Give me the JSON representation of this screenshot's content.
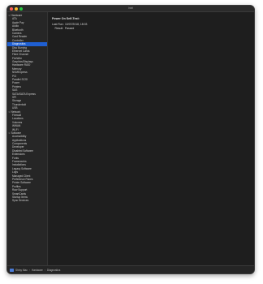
{
  "window": {
    "title": "Intel",
    "colors": {
      "close": "#ff5f57",
      "minimize": "#febc2e",
      "zoom": "#28c840",
      "selection": "#1f5fd1"
    }
  },
  "sidebar": {
    "groups": [
      {
        "label": "Hardware",
        "items": [
          "ATA",
          "Apple Pay",
          "Audio",
          "Bluetooth",
          "Camera",
          "Card Reader",
          "Controller",
          "Diagnostics",
          "Disc Burning",
          "Ethernet Cards",
          "Fibre Channel",
          "FireWire",
          "Graphics/Displays",
          "Hardware RAID",
          "Memory",
          "NVMExpress",
          "PCI",
          "Parallel SCSI",
          "Power",
          "Printers",
          "SAS",
          "SATA/SATA Express",
          "SPI",
          "Storage",
          "Thunderbolt",
          "USB"
        ]
      },
      {
        "label": "Network",
        "items": [
          "Firewall",
          "Locations",
          "Volumes",
          "WWAN",
          "Wi-Fi"
        ]
      },
      {
        "label": "Software",
        "items": [
          "Accessibility",
          "Applications",
          "Components",
          "Developer",
          "Disabled Software",
          "Extensions",
          "Fonts",
          "Frameworks",
          "Installations",
          "Legacy Software",
          "Logs",
          "Managed Client",
          "Preference Panes",
          "Printer Software",
          "Profiles",
          "Raw Support",
          "SmartCards",
          "Startup Items",
          "Sync Services"
        ]
      }
    ],
    "selected": "Diagnostics"
  },
  "detail": {
    "heading": "Power On Self-Test:",
    "rows": [
      {
        "key": "Last Run:",
        "value": "10/07/2018, 18:03"
      },
      {
        "key": "Result:",
        "value": "Passed"
      }
    ]
  },
  "status": {
    "path": [
      "Shiny Mac",
      "Hardware",
      "Diagnostics"
    ],
    "separator": "›",
    "icon": "computer-icon"
  }
}
